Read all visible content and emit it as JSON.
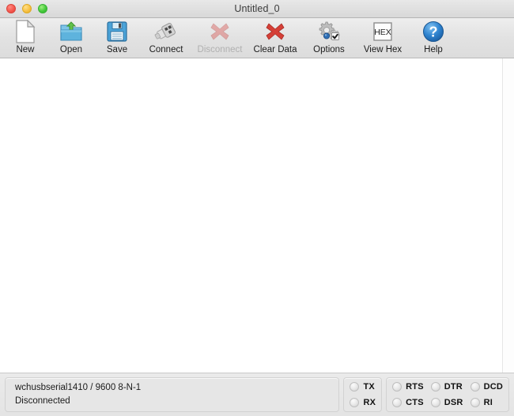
{
  "window": {
    "title": "Untitled_0",
    "traffic_lights": [
      {
        "name": "close",
        "color": "#f5584f"
      },
      {
        "name": "minimize",
        "color": "#f7c144"
      },
      {
        "name": "zoom",
        "color": "#45c93c"
      }
    ]
  },
  "toolbar": {
    "items": [
      {
        "label": "New",
        "icon": "new-document-icon",
        "enabled": true
      },
      {
        "label": "Open",
        "icon": "open-folder-icon",
        "enabled": true
      },
      {
        "label": "Save",
        "icon": "floppy-disk-icon",
        "enabled": true
      },
      {
        "label": "Connect",
        "icon": "usb-plug-icon",
        "enabled": true
      },
      {
        "label": "Disconnect",
        "icon": "usb-plug-icon",
        "enabled": false
      },
      {
        "label": "Clear Data",
        "icon": "red-x-icon",
        "enabled": true
      },
      {
        "label": "Options",
        "icon": "gears-icon",
        "enabled": true
      },
      {
        "label": "View Hex",
        "icon": "hex-box-icon",
        "enabled": true
      },
      {
        "label": "Help",
        "icon": "question-mark-icon",
        "enabled": true
      }
    ],
    "hex_button_text": "HEX"
  },
  "terminal": {
    "text": ""
  },
  "status": {
    "port_line": "wchusbserial1410 / 9600 8-N-1",
    "connection_line": "Disconnected"
  },
  "leds": {
    "data_group": {
      "columns": [
        {
          "rows": [
            {
              "label": "TX",
              "on": false
            },
            {
              "label": "RX",
              "on": false
            }
          ]
        }
      ]
    },
    "control_group": {
      "columns": [
        {
          "rows": [
            {
              "label": "RTS",
              "on": false
            },
            {
              "label": "CTS",
              "on": false
            }
          ]
        },
        {
          "rows": [
            {
              "label": "DTR",
              "on": false
            },
            {
              "label": "DSR",
              "on": false
            }
          ]
        },
        {
          "rows": [
            {
              "label": "DCD",
              "on": false
            },
            {
              "label": "RI",
              "on": false
            }
          ]
        }
      ]
    }
  },
  "colors": {
    "window_bg": "#ececec",
    "content_bg": "#ffffff",
    "accent_blue": "#2a7fd4",
    "danger_red": "#d33b30",
    "led_off": "#e6e6e6"
  }
}
